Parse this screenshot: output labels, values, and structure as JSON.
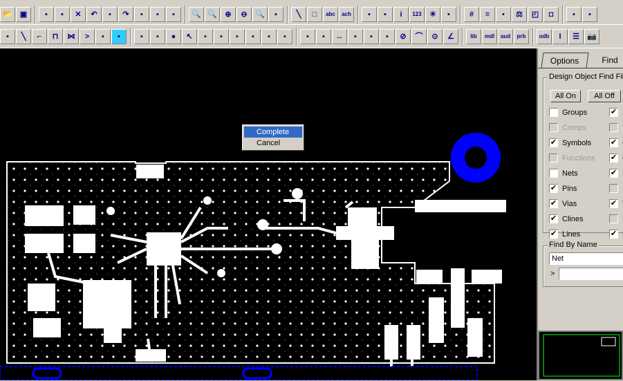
{
  "toolbar": {
    "row1": [
      "open-icon",
      "save-icon",
      "|",
      "assign-color-icon",
      "assign-color2-icon",
      "delete-icon",
      "undo-icon",
      "undo-step-icon",
      "redo-icon",
      "redo-step-icon",
      "shadow-icon",
      "unplace-icon",
      "|",
      "zoom-points-icon",
      "zoom-fit-icon",
      "zoom-in-icon",
      "zoom-out-icon",
      "zoom-world-icon",
      "redraw-icon",
      "|",
      "add-line-icon",
      "add-rect-icon",
      "add-text-icon",
      "change-text-icon",
      "|",
      "color-icon",
      "layer-vis-icon",
      "info-icon",
      "measure-icon",
      "highlight-icon",
      "dehighlight-icon",
      "|",
      "grid-icon",
      "layers-icon",
      "constraint-icon",
      "balance-icon",
      "boundary-icon",
      "fit-icon",
      "|",
      "place-icon",
      "drc-icon"
    ],
    "row2": [
      "flash-icon",
      "add-connect-icon",
      "slide-icon",
      "delay-tune-icon",
      "swap-icon",
      "fanout-icon",
      "route-icon",
      "autoroute-icon",
      "|",
      "shape-poly-icon",
      "shape-rect-icon",
      "shape-circle-icon",
      "select-icon",
      "manual-void-icon",
      "edit-boundary-icon",
      "shape-void-icon",
      "circle-void-icon",
      "shape-merge-icon",
      "shape-check-icon",
      "|",
      "dim-icon",
      "dim-linear-icon",
      "dim-ext-icon",
      "dim-ordinate-icon",
      "dim-angle-icon",
      "leader-icon",
      "diameter-icon",
      "radius-icon",
      "chamfer-icon",
      "fillet-icon",
      "|",
      "lib-icon",
      "mdl-icon",
      "aud-icon",
      "prb-icon",
      "|",
      "odb-icon",
      "padstack-icon",
      "report-icon",
      "snapshot-icon"
    ],
    "glyphs": {
      "open-icon": "📂",
      "save-icon": "▣",
      "delete-icon": "✕",
      "undo-icon": "↶",
      "redo-icon": "↷",
      "zoom-points-icon": "🔍",
      "zoom-fit-icon": "🔍",
      "zoom-in-icon": "⊕",
      "zoom-out-icon": "⊖",
      "zoom-world-icon": "🔍",
      "add-line-icon": "╲",
      "add-rect-icon": "□",
      "add-text-icon": "abc",
      "change-text-icon": "ach",
      "info-icon": "i",
      "measure-icon": "123",
      "highlight-icon": "☀",
      "grid-icon": "#",
      "layers-icon": "≡",
      "balance-icon": "⚖",
      "boundary-icon": "◰",
      "fit-icon": "◘",
      "add-connect-icon": "╲",
      "slide-icon": "⌐",
      "delay-tune-icon": "⊓",
      "swap-icon": "⋈",
      "fanout-icon": ">",
      "select-icon": "↖",
      "shape-circle-icon": "●",
      "dim-ext-icon": "↔",
      "diameter-icon": "⊘",
      "radius-icon": "⌒",
      "chamfer-icon": "⊙",
      "fillet-icon": "∠",
      "lib-icon": "lib",
      "mdl-icon": "mdl",
      "aud-icon": "aud",
      "prb-icon": "prb",
      "odb-icon": "odb",
      "padstack-icon": "I",
      "report-icon": "☰",
      "snapshot-icon": "📷"
    },
    "active": "autoroute-icon"
  },
  "context_menu": {
    "items": [
      "Complete",
      "Cancel"
    ],
    "selected": "Complete"
  },
  "panel": {
    "tabs": [
      "Options",
      "Find"
    ],
    "active_tab": "Find",
    "filter_group": "Design Object Find Filter",
    "all_on": "All On",
    "all_off": "All Off",
    "left": [
      {
        "label": "Groups",
        "checked": false,
        "enabled": true
      },
      {
        "label": "Comps",
        "checked": false,
        "enabled": false
      },
      {
        "label": "Symbols",
        "checked": true,
        "enabled": true
      },
      {
        "label": "Functions",
        "checked": false,
        "enabled": false
      },
      {
        "label": "Nets",
        "checked": false,
        "enabled": true
      },
      {
        "label": "Pins",
        "checked": true,
        "enabled": true
      },
      {
        "label": "Vias",
        "checked": true,
        "enabled": true
      },
      {
        "label": "Clines",
        "checked": true,
        "enabled": true
      },
      {
        "label": "Lines",
        "checked": true,
        "enabled": true
      }
    ],
    "right": [
      {
        "label": "S",
        "checked": true,
        "enabled": true
      },
      {
        "label": "V",
        "checked": false,
        "enabled": false
      },
      {
        "label": "C",
        "checked": true,
        "enabled": true
      },
      {
        "label": "O",
        "checked": true,
        "enabled": true
      },
      {
        "label": "F",
        "checked": true,
        "enabled": true
      },
      {
        "label": "D",
        "checked": false,
        "enabled": false
      },
      {
        "label": "T",
        "checked": true,
        "enabled": true
      },
      {
        "label": "R",
        "checked": false,
        "enabled": false
      },
      {
        "label": "R",
        "checked": true,
        "enabled": true
      }
    ],
    "find_by_name": "Find By Name",
    "name_type": "Net",
    "name_prompt": ">",
    "name_value": ""
  },
  "colors": {
    "board": "#ffffff",
    "canvas": "#000000",
    "ring": "#0000ff",
    "menu_select": "#316ac5"
  }
}
